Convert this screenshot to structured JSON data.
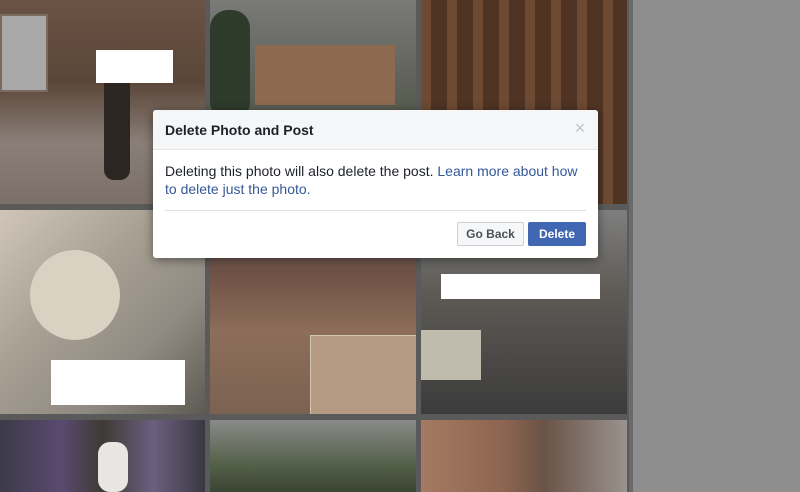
{
  "dialog": {
    "title": "Delete Photo and Post",
    "close_glyph": "×",
    "message": "Deleting this photo will also delete the post.",
    "link_text": "Learn more about how to delete just the photo.",
    "back_label": "Go Back",
    "delete_label": "Delete"
  },
  "photos": {
    "count": 9,
    "items": [
      "interior-construction",
      "house-with-trees",
      "wood-framing",
      "child-and-cat",
      "city-landscape",
      "children-on-bed",
      "bunny-child",
      "palm-street",
      "magazine-lips"
    ]
  },
  "colors": {
    "primary_button": "#4267b2",
    "link": "#365899",
    "overlay": "#000000"
  }
}
